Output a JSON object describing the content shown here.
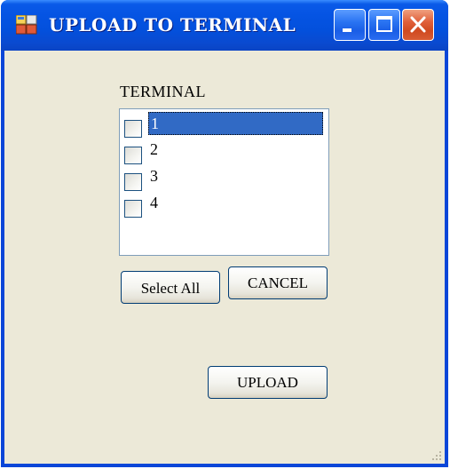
{
  "window": {
    "title": "UPLOAD TO TERMINAL"
  },
  "titlebar_buttons": {
    "minimize": "minimize",
    "maximize": "maximize",
    "close": "close"
  },
  "form": {
    "terminal_label": "TERMINAL",
    "terminals": [
      {
        "label": "1",
        "checked": false,
        "selected": true
      },
      {
        "label": "2",
        "checked": false,
        "selected": false
      },
      {
        "label": "3",
        "checked": false,
        "selected": false
      },
      {
        "label": "4",
        "checked": false,
        "selected": false
      }
    ],
    "select_all_label": "Select All",
    "cancel_label": "CANCEL",
    "upload_label": "UPLOAD"
  },
  "colors": {
    "titlebar_blue": "#0554e3",
    "selection_blue": "#316ac5",
    "dialog_background": "#ece9d8",
    "close_button_red": "#d04a20"
  }
}
